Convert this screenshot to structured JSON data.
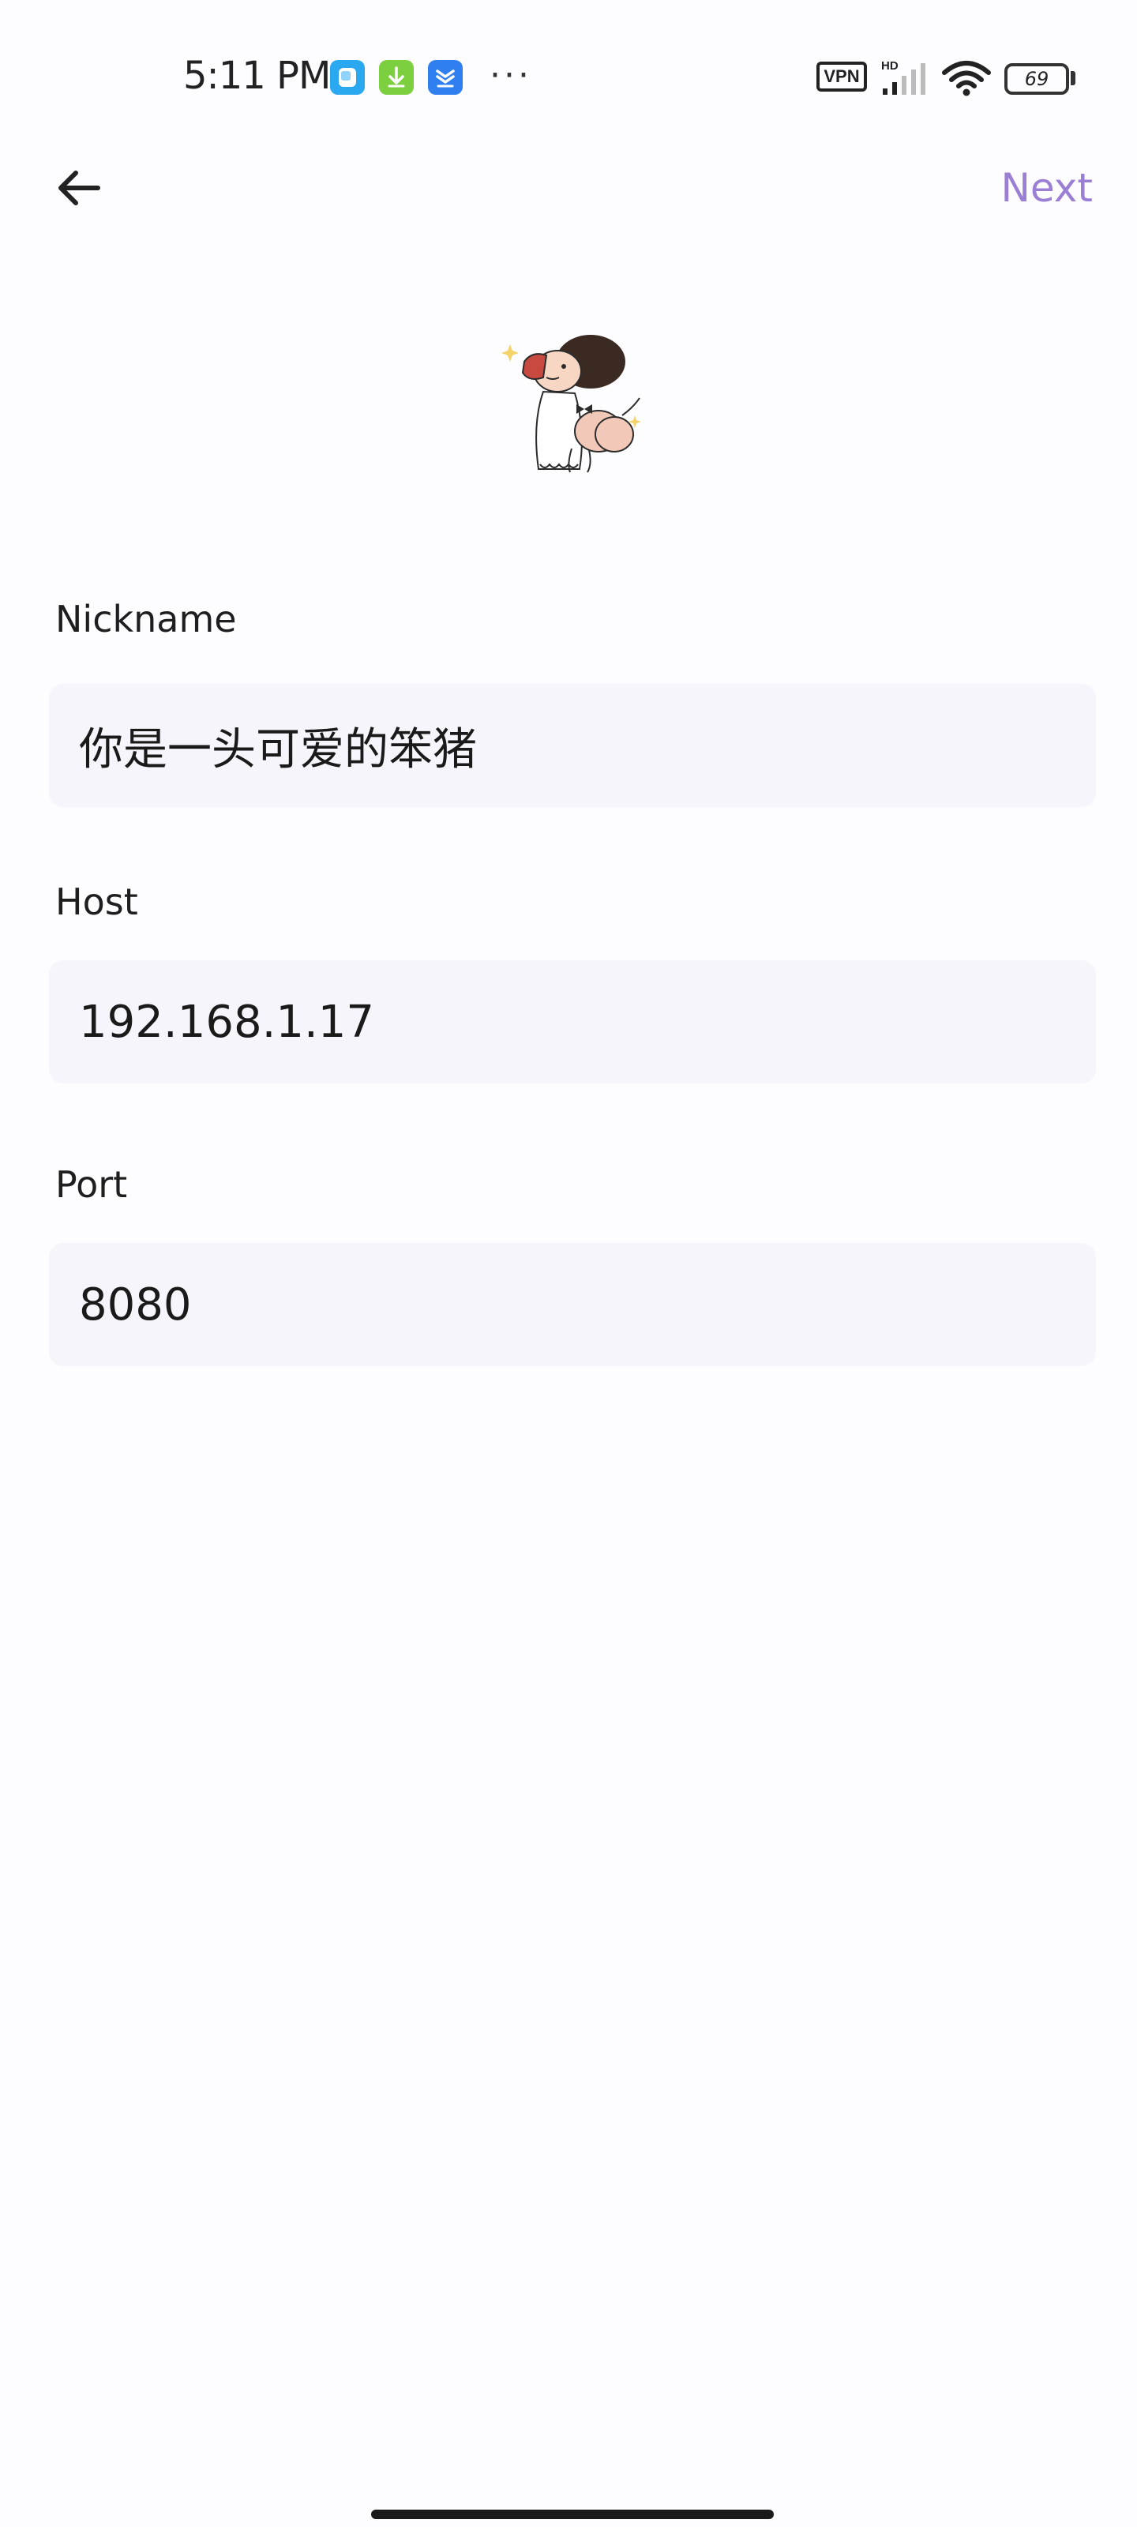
{
  "status_bar": {
    "time": "5:11 PM",
    "more": "···",
    "vpn": "VPN",
    "network": "HD",
    "battery": "69",
    "icons": [
      "blue-app-icon",
      "green-download-icon",
      "blue-layers-icon"
    ]
  },
  "header": {
    "back_icon": "arrow-left-icon",
    "next_label": "Next"
  },
  "form": {
    "nickname": {
      "label": "Nickname",
      "value": "你是一头可爱的笨猪"
    },
    "host": {
      "label": "Host",
      "value": "192.168.1.17"
    },
    "port": {
      "label": "Port",
      "value": "8080"
    }
  },
  "colors": {
    "accent": "#9b7fd4",
    "field_bg": "#f5f5fb",
    "page_bg": "#fdfcfe"
  }
}
